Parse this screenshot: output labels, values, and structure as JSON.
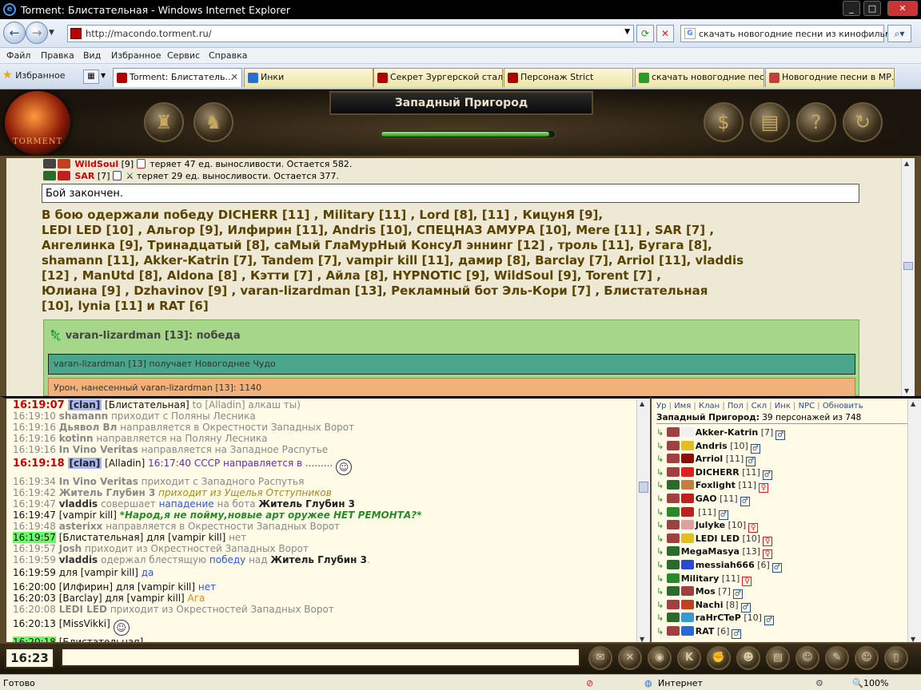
{
  "browser": {
    "window_title": "Torment: Блистательная - Windows Internet Explorer",
    "url": "http://macondo.torment.ru/",
    "search_text": "скачать новогодние песни из кинофильмов",
    "menu": [
      "Файл",
      "Правка",
      "Вид",
      "Избранное",
      "Сервис",
      "Справка"
    ],
    "favorites_label": "Избранное",
    "tabs": [
      {
        "label": "Torment: Блистатель...",
        "active": true,
        "color": "#b00000"
      },
      {
        "label": "Инки",
        "active": false,
        "color": "#2a6fd0"
      },
      {
        "label": "Секрет Зургерской стали",
        "active": false,
        "color": "#b00000"
      },
      {
        "label": "Персонаж Strict",
        "active": false,
        "color": "#b00000"
      },
      {
        "label": "скачать новогодние пес...",
        "active": false,
        "color": "#2a9a2a"
      },
      {
        "label": "Новогодние песни в МР...",
        "active": false,
        "color": "#c04040"
      }
    ],
    "status": {
      "ready": "Готово",
      "zone": "Интернет",
      "zoom": "100%"
    }
  },
  "game": {
    "logo_text": "TORMENT",
    "location": "Западный Пригород",
    "hp_level": 0.97,
    "header_icons_left": [
      "castle-icon",
      "knight-icon"
    ],
    "header_icons_right": [
      "money-bag-icon",
      "scroll-icon",
      "question-icon",
      "refresh-icon"
    ]
  },
  "battle": {
    "log": [
      {
        "name": "WildSoul",
        "level": "[9]",
        "text": "теряет 47 ед. выносливости. Остается 582."
      },
      {
        "name": "SAR",
        "level": "[7]",
        "text": "теряет 29 ед. выносливости. Остается 377."
      }
    ],
    "fight_over": "Бой закончен.",
    "winners_lines": [
      "В бою одержали победу  DICHERR [11] ,  Military [11] ,  Lord [8],                       [11] ,  КицунЯ [9],",
      "LEDI LED [10] ,  Альгор [9], Илфирин [11],  Andris [10],  СПЕЦНАЗ АМУРА [10],  Mere [11] ,  SAR [7] ,",
      " Ангелинка [9],  Тринадцатый [8],   сaМый ГлаМурНый КонсуЛ эннинг [12] ,  троль [11],  Бугага [8],",
      "shamann [11],  Akker-Katrin [7], Tandem [7],  vampir kill [11],    дамир [8],  Barclay [7],  Arriol [11],  vladdis",
      "[12] ,  ManUtd [8],  Aldona [8] ,  Кэтти [7] ,  Айла [8],  HYPNOTIC [9],  WildSoul [9],  Torent [7] ,",
      "Юлиана [9] ,  Dzhavinov [9] ,  varan-lizardman [13],   Рекламный бот Эль-Кори [7] ,    Блистательная",
      "[10],  lynia [11]  и  RAT [6]"
    ],
    "victory_title": "varan-lizardman [13]: победа",
    "gift_line": "varan-lizardman [13] получает Новогоднее Чудо",
    "damage_line": "Урон, нанесенный   varan-lizardman [13]: 1140"
  },
  "chat": [
    {
      "time": "16:19:07",
      "style": "clan",
      "parts": [
        [
          "clanbadge",
          "[clan]"
        ],
        [
          "who",
          " [Блистательная]"
        ],
        [
          "t",
          " to [Alladin] алкаш ты)"
        ]
      ]
    },
    {
      "time": "16:19:10",
      "style": "",
      "parts": [
        [
          "pn",
          "shamann"
        ],
        [
          "t",
          " приходит с Поляны Лесника"
        ]
      ]
    },
    {
      "time": "16:19:16",
      "style": "",
      "parts": [
        [
          "pn",
          "Дьявол Вл"
        ],
        [
          "t",
          " направляется в Окрестности Западных Ворот"
        ]
      ]
    },
    {
      "time": "16:19:16",
      "style": "",
      "parts": [
        [
          "pn",
          "kotinn"
        ],
        [
          "t",
          " направляется на Поляну Лесника"
        ]
      ]
    },
    {
      "time": "16:19:16",
      "style": "",
      "parts": [
        [
          "pn",
          "In Vino Veritas"
        ],
        [
          "t",
          " направляется на Западное Распутье"
        ]
      ]
    },
    {
      "time": "16:19:18",
      "style": "clan",
      "parts": [
        [
          "clanbadge",
          "[clan]"
        ],
        [
          "who",
          " [Alladin] "
        ],
        [
          "purple",
          "16:17:40 СССР направляется в ......... "
        ],
        [
          "smiley",
          "☺"
        ]
      ]
    },
    {
      "time": "16:19:34",
      "style": "",
      "parts": [
        [
          "pn",
          "In Vino Veritas"
        ],
        [
          "t",
          " приходит с Западного Распутья"
        ]
      ]
    },
    {
      "time": "16:19:42",
      "style": "",
      "parts": [
        [
          "pn",
          "Житель Глубин 3"
        ],
        [
          "ochre-it",
          " приходит из Ущелья Отступников"
        ]
      ]
    },
    {
      "time": "16:19:47",
      "style": "",
      "parts": [
        [
          "pn dark",
          "vladdis"
        ],
        [
          "t",
          " совершает "
        ],
        [
          "blue",
          "нападение"
        ],
        [
          "t",
          " на бота "
        ],
        [
          "bold",
          "Житель Глубин 3"
        ]
      ]
    },
    {
      "time": "16:19:47",
      "style": "dark",
      "parts": [
        [
          "who",
          "[vampir kill] "
        ],
        [
          "green-it",
          "*Народ,я не пойму,новые арт оружее НЕТ РЕМОНТА?*"
        ]
      ]
    },
    {
      "time": "16:19:48",
      "style": "",
      "parts": [
        [
          "pn",
          "asterixx"
        ],
        [
          "t",
          " направляется в Окрестности Западных Ворот"
        ]
      ]
    },
    {
      "time": "16:19:57",
      "style": "hl",
      "parts": [
        [
          "who",
          "[Блистательная] для [vampir kill]"
        ],
        [
          "t",
          " нет"
        ]
      ]
    },
    {
      "time": "16:19:57",
      "style": "",
      "parts": [
        [
          "pn",
          "Josh"
        ],
        [
          "t",
          " приходит из Окрестностей Западных Ворот"
        ]
      ]
    },
    {
      "time": "16:19:59",
      "style": "",
      "parts": [
        [
          "pn dark",
          "vladdis"
        ],
        [
          "t",
          " одержал блестящую "
        ],
        [
          "blue",
          "победу"
        ],
        [
          "t",
          " над "
        ],
        [
          "bold",
          "Житель Глубин 3"
        ],
        [
          "t",
          "."
        ]
      ]
    },
    {
      "time": "16:19:59",
      "style": "dark",
      "parts": [
        [
          "who",
          "                     для [vampir kill] "
        ],
        [
          "blue",
          "да"
        ]
      ]
    },
    {
      "time": "16:20:00",
      "style": "dark",
      "parts": [
        [
          "who",
          "[Илфирин] для [vampir kill] "
        ],
        [
          "blue",
          "нет"
        ]
      ]
    },
    {
      "time": "16:20:03",
      "style": "dark",
      "parts": [
        [
          "who",
          "[Barclay] для [vampir kill] "
        ],
        [
          "orange",
          "Ага"
        ]
      ]
    },
    {
      "time": "16:20:08",
      "style": "",
      "parts": [
        [
          "pn",
          "LEDI LED"
        ],
        [
          "t",
          " приходит из Окрестностей Западных Ворот"
        ]
      ]
    },
    {
      "time": "16:20:13",
      "style": "dark",
      "parts": [
        [
          "who",
          "[MissVikki] "
        ],
        [
          "smiley",
          "☺"
        ]
      ]
    },
    {
      "time": "16:20:18",
      "style": "hl",
      "parts": [
        [
          "who",
          "[Блистательная] ........"
        ]
      ]
    }
  ],
  "players": {
    "toolbar": [
      "Ур",
      "Имя",
      "Клан",
      "Пол",
      "Скл",
      "Инк",
      "NPC",
      "Обновить"
    ],
    "location_label": "Западный Пригород:",
    "count_text": "39 персонажей из 748",
    "list": [
      {
        "name": "Akker-Katrin",
        "level": "[7]",
        "sex": "m",
        "c1": "#a04040",
        "c2": "#f0f0f0"
      },
      {
        "name": "Andris",
        "level": "[10]",
        "sex": "m",
        "c1": "#a04040",
        "c2": "#e0c020"
      },
      {
        "name": "Arriol",
        "level": "[11]",
        "sex": "m",
        "c1": "#a04040",
        "c2": "#8a1010"
      },
      {
        "name": "DICHERR",
        "level": "[11]",
        "sex": "m",
        "c1": "#a04040",
        "c2": "#e02020"
      },
      {
        "name": "Foxlight",
        "level": "[11]",
        "sex": "f",
        "c1": "#2a6a2a",
        "c2": "#c08040"
      },
      {
        "name": "GAO",
        "level": "[11]",
        "sex": "m",
        "c1": "#a04040",
        "c2": "#c02020"
      },
      {
        "name": "",
        "level": "[11]",
        "sex": "m",
        "c1": "#2a8a2a",
        "c2": "#c02020"
      },
      {
        "name": "Julyke",
        "level": "[10]",
        "sex": "f",
        "c1": "#a04040",
        "c2": "#e0a0a0"
      },
      {
        "name": "LEDI LED",
        "level": "[10]",
        "sex": "f",
        "c1": "#a04040",
        "c2": "#e0c020"
      },
      {
        "name": "MegaMasya",
        "level": "[13]",
        "sex": "f",
        "c1": "#2a6a2a",
        "c2": ""
      },
      {
        "name": "messiah666",
        "level": "[6]",
        "sex": "m",
        "c1": "#2a6a2a",
        "c2": "#2a4ad0"
      },
      {
        "name": "Military",
        "level": "[11]",
        "sex": "f",
        "c1": "#2a8a2a",
        "c2": ""
      },
      {
        "name": "Mos",
        "level": "[7]",
        "sex": "m",
        "c1": "#2a6a2a",
        "c2": "#a04040"
      },
      {
        "name": "Nachi",
        "level": "[8]",
        "sex": "m",
        "c1": "#a04040",
        "c2": "#c04020"
      },
      {
        "name": "raHrCTeP",
        "level": "[10]",
        "sex": "m",
        "c1": "#2a6a2a",
        "c2": "#3a9ad0"
      },
      {
        "name": "RAT",
        "level": "[6]",
        "sex": "m",
        "c1": "#a04040",
        "c2": "#2a6ad0"
      }
    ]
  },
  "bottom": {
    "clock": "16:23",
    "chat_input_value": "",
    "buttons": [
      "chat-bubble-icon",
      "close-icon",
      "mask-icon",
      "k-icon",
      "fist-icon",
      "people-icon",
      "book-icon",
      "group-icon",
      "wrench-icon",
      "smile-icon",
      "door-icon"
    ]
  },
  "colors": {
    "accent_frame": "#5a4a2a",
    "log_bg": "#ede9d4",
    "victory_green": "#a6d68a",
    "gift_teal": "#4aa58a",
    "damage_orange": "#f0b27a"
  }
}
